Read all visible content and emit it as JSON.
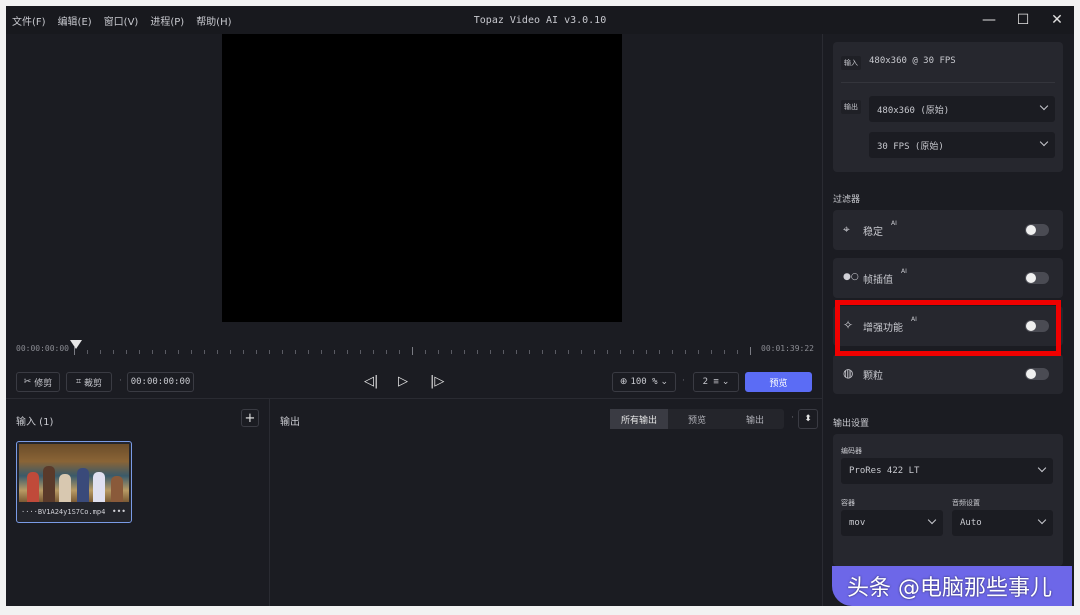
{
  "menu": [
    "文件(F)",
    "编辑(E)",
    "窗口(V)",
    "进程(P)",
    "帮助(H)"
  ],
  "app_title": "Topaz Video AI  v3.0.10",
  "window_controls": {
    "minimize": "—",
    "maximize": "☐",
    "close": "✕"
  },
  "timeline": {
    "start": "00:00:00:00",
    "end": "00:01:39:22"
  },
  "controls": {
    "trim": "修剪",
    "crop": "裁剪",
    "timecode": "00:00:00:00",
    "zoom": "100 %",
    "speed": "2 ≡",
    "preview": "预览"
  },
  "input_pane": {
    "title": "输入 (1)",
    "add": "+",
    "file_name": "····BV1A24y1S7Co.mp4",
    "more": "•••"
  },
  "output_pane": {
    "title": "输出",
    "tabs": [
      "所有输出",
      "预览",
      "输出"
    ],
    "active_tab": 0,
    "sort": "⬍"
  },
  "io": {
    "input_tag": "输入",
    "input_value": "480x360 @ 30 FPS",
    "output_tag": "输出",
    "resolution_select": "480x360 (原始)",
    "fps_select": "30 FPS (原始)"
  },
  "filters": {
    "section": "过滤器",
    "items": [
      {
        "icon": "⌖",
        "label": "稳定",
        "ai": "AI",
        "enabled": false
      },
      {
        "icon": "●○",
        "label": "帧插值",
        "ai": "AI",
        "enabled": false
      },
      {
        "icon": "✧",
        "label": "增强功能",
        "ai": "AI",
        "enabled": false
      },
      {
        "icon": "◍",
        "label": "颗粒",
        "ai": "",
        "enabled": false
      }
    ]
  },
  "output_settings": {
    "section": "输出设置",
    "encoder_label": "编码器",
    "encoder_value": "ProRes 422 LT",
    "container_label": "容器",
    "container_value": "mov",
    "audio_label": "音频设置",
    "audio_value": "Auto"
  },
  "watermark": "头条 @电脑那些事儿",
  "colors": {
    "accent": "#5b6cf5",
    "highlight": "#f00000"
  }
}
